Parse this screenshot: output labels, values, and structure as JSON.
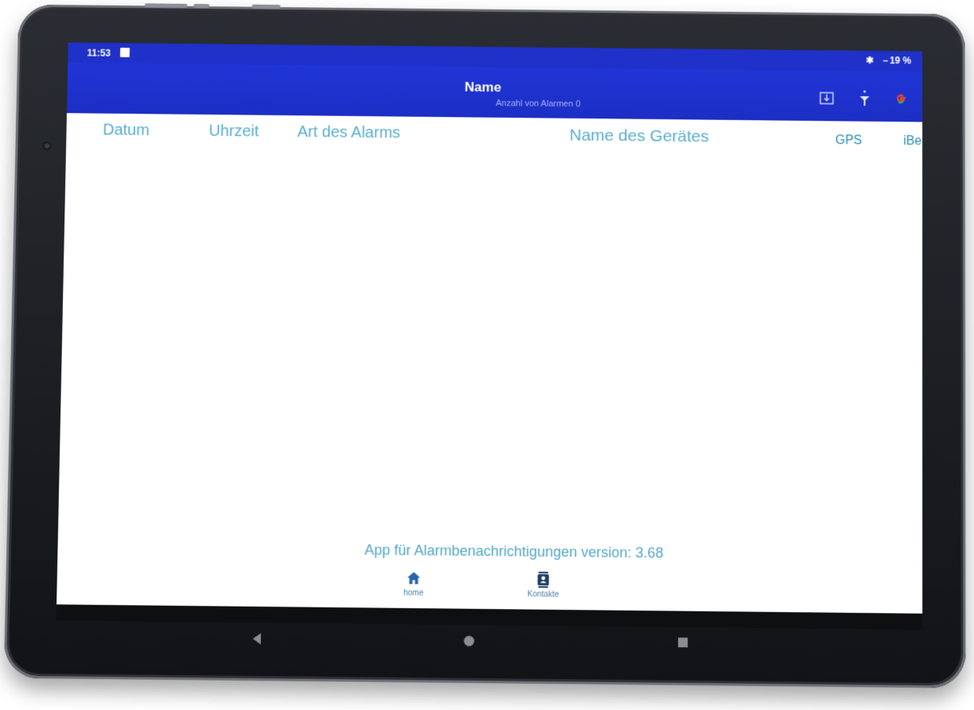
{
  "status_bar": {
    "time": "11:53",
    "bluetooth_icon": "bluetooth-icon",
    "battery_text": "19 %"
  },
  "app_bar": {
    "title": "Name",
    "subtitle": "Anzahl von Alarmen 0",
    "icons": [
      "download-icon",
      "lamp-icon",
      "google-icon"
    ],
    "color": "#1f31c9"
  },
  "table": {
    "columns": [
      "Datum",
      "Uhrzeit",
      "Art des Alarms",
      "Name des Gerätes",
      "GPS",
      "iBe"
    ],
    "rows": []
  },
  "footer": {
    "version_text": "App für Alarmbenachrichtigungen version: 3.68"
  },
  "bottom_nav": [
    {
      "label": "home",
      "icon": "home-icon"
    },
    {
      "label": "Kontakte",
      "icon": "contacts-icon"
    }
  ],
  "system_nav": [
    "back-icon",
    "home-circle-icon",
    "recents-icon"
  ],
  "colors": {
    "header_text": "#5aaed0",
    "accent": "#2b8ab6"
  }
}
